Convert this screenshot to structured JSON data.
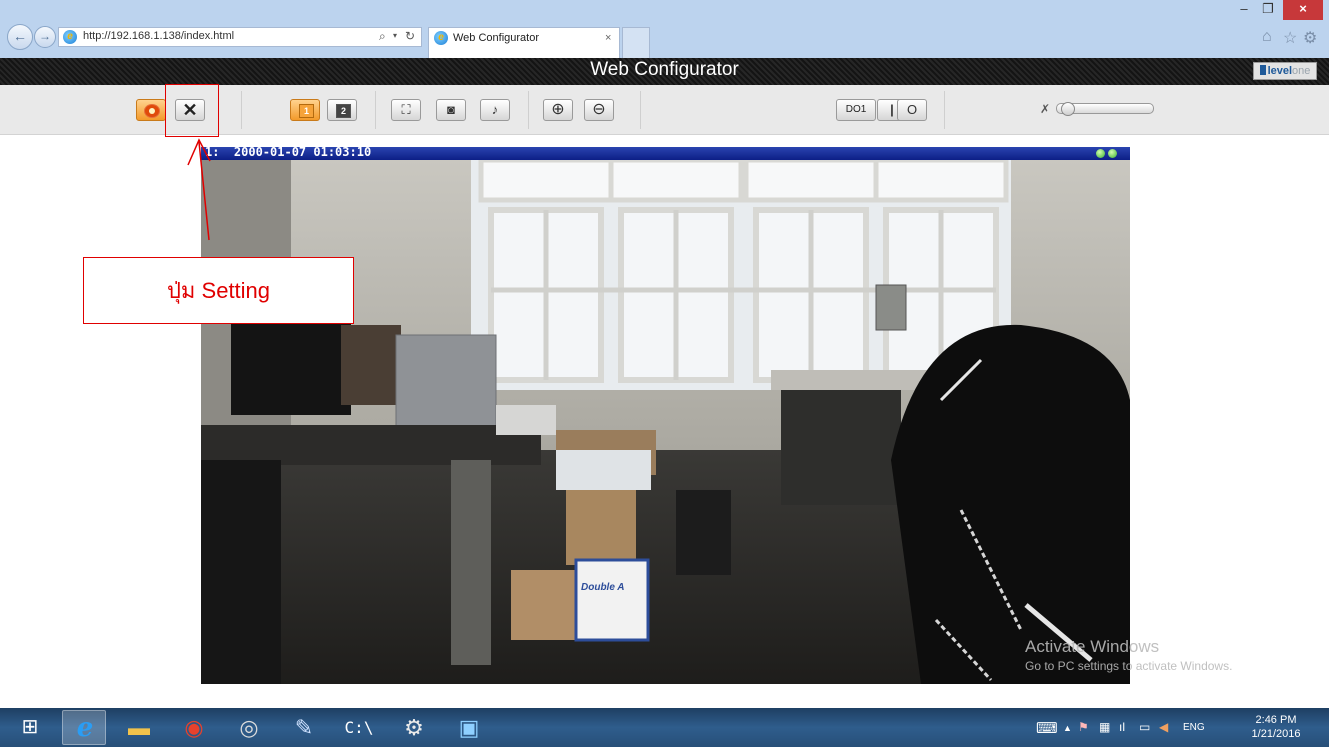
{
  "browser": {
    "url": "http://192.168.1.138/index.html",
    "tab_title": "Web Configurator",
    "back_glyph": "←",
    "forward_glyph": "→",
    "search_glyph": "⌕",
    "dropdown_glyph": "▾",
    "refresh_glyph": "↻",
    "close_tab_glyph": "×",
    "window_controls": {
      "minimize": "–",
      "maximize": "❐",
      "close": "×"
    },
    "toolbar_icons": {
      "home": "⌂",
      "favorites": "☆",
      "tools": "⚙"
    }
  },
  "app": {
    "title": "Web Configurator",
    "logo": {
      "bold": "level",
      "light": "one"
    }
  },
  "toolbar": {
    "buttons": [
      {
        "name": "live-view",
        "active": true
      },
      {
        "name": "setting",
        "glyph": "✕"
      },
      {
        "name": "layout-1",
        "label": "1",
        "active": true
      },
      {
        "name": "layout-2",
        "label": "2"
      },
      {
        "name": "fullscreen",
        "glyph": "⛶"
      },
      {
        "name": "snapshot",
        "glyph": "◙"
      },
      {
        "name": "microphone",
        "glyph": "♪"
      },
      {
        "name": "zoom-in",
        "glyph": "⊕"
      },
      {
        "name": "zoom-out",
        "glyph": "⊖"
      }
    ],
    "digital_output": {
      "label": "DO1",
      "on_glyph": "|",
      "off_glyph": "O"
    },
    "mute_glyph": "✗",
    "volume": 0.05
  },
  "camera": {
    "channel": "1:",
    "timestamp": "2000-01-07 01:03:10",
    "box_label": "Double A"
  },
  "annotation": {
    "callout_text": "ปุ่ม Setting",
    "color": "#e00000"
  },
  "watermark": {
    "title": "Activate Windows",
    "subtitle": "Go to PC settings to activate Windows."
  },
  "taskbar": {
    "apps": [
      "start",
      "internet-explorer",
      "file-explorer",
      "chrome",
      "camera-app",
      "paint",
      "command-prompt",
      "settings",
      "display"
    ],
    "active_app": "internet-explorer",
    "start_glyph": "⊞",
    "ie_glyph": "e",
    "explorer_glyph": "▬",
    "chrome_glyph": "◉",
    "cam_glyph": "◎",
    "paint_glyph": "✎",
    "cmd_glyph": "C:\\",
    "settings_glyph": "⚙",
    "display_glyph": "▣",
    "tray": {
      "keyboard": "⌨",
      "up": "▲",
      "flag": "⚑",
      "network": "▦",
      "signal": "ıl",
      "power": "▭",
      "volume": "◀",
      "lang": "ENG"
    },
    "clock": {
      "time": "2:46 PM",
      "date": "1/21/2016"
    }
  }
}
